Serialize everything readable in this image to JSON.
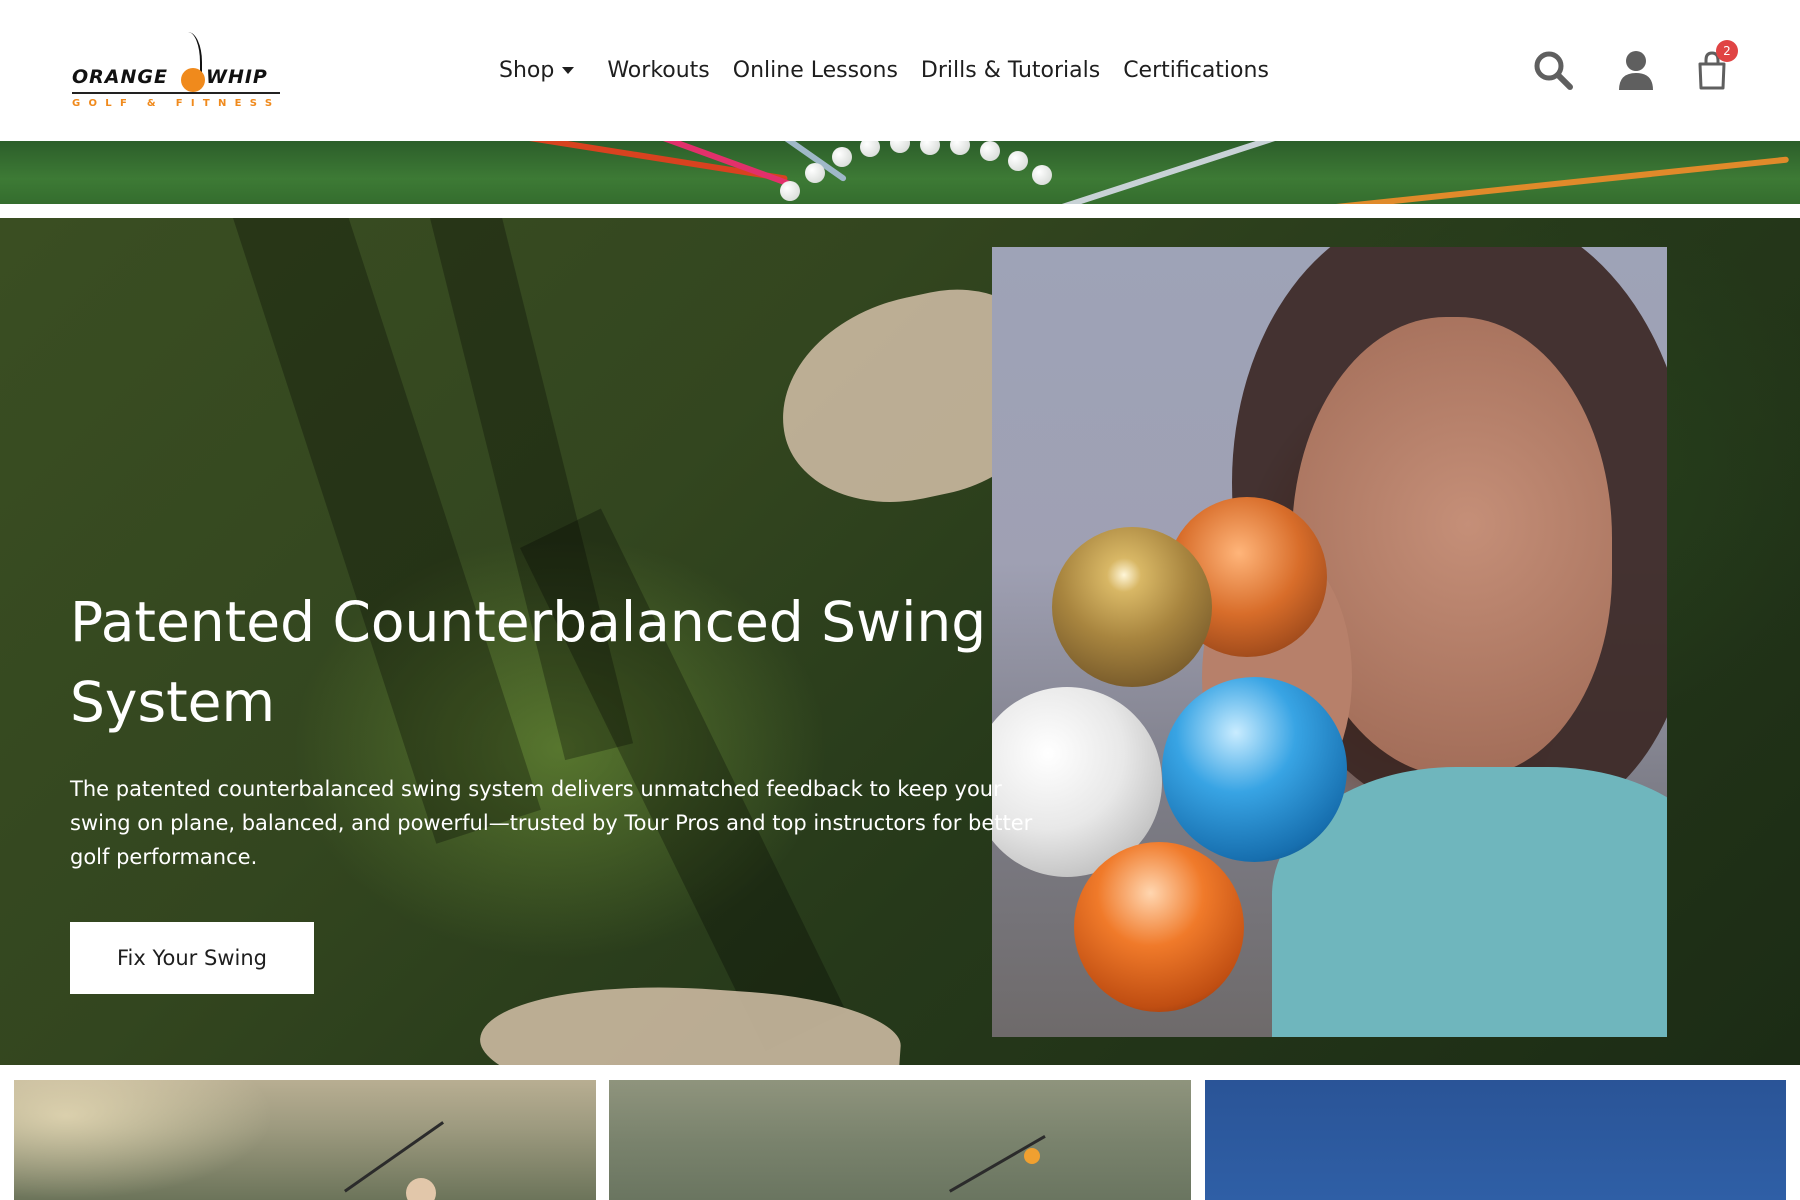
{
  "brand": {
    "logo_word_left": "ORANGE",
    "logo_word_right": "WHIP",
    "logo_tagline": "GOLF & FITNESS",
    "accent_color": "#f08a1c"
  },
  "nav": {
    "items": [
      {
        "label": "Shop",
        "has_dropdown": true
      },
      {
        "label": "Workouts"
      },
      {
        "label": "Online Lessons"
      },
      {
        "label": "Drills & Tutorials"
      },
      {
        "label": "Certifications"
      }
    ]
  },
  "header_icons": {
    "search": "search-icon",
    "account": "user-icon",
    "cart": "shopping-bag-icon",
    "cart_count": "2"
  },
  "hero": {
    "title": "Patented Counterbalanced Swing System",
    "text": "The patented counterbalanced swing system delivers unmatched feedback to keep your swing on plane, balanced, and powerful—trusted by Tour Pros and top instructors for better golf performance.",
    "button_label": "Fix Your Swing"
  }
}
